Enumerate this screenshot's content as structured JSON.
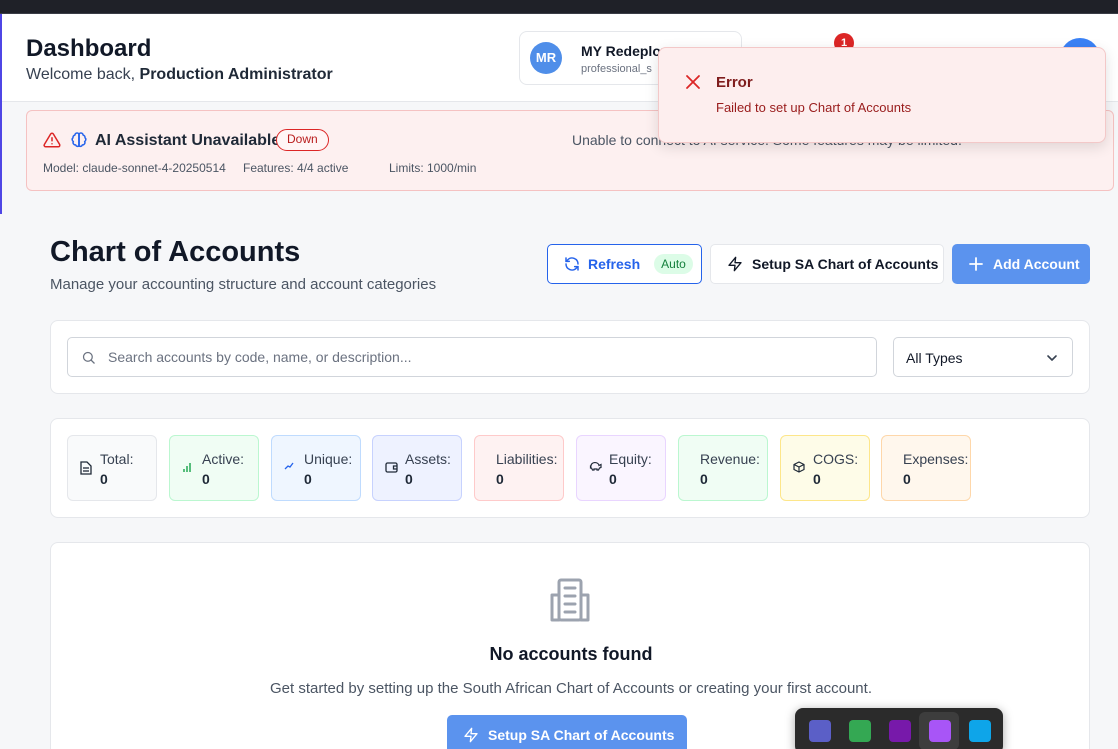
{
  "header": {
    "title": "Dashboard",
    "welcome_prefix": "Welcome back, ",
    "user_name": "Production Administrator"
  },
  "company": {
    "initials": "MR",
    "name": "MY Redeploy",
    "plan": "professional_s"
  },
  "notifications": {
    "count": "1"
  },
  "ai_status": {
    "title": "AI Assistant Unavailable",
    "status_badge": "Down",
    "message": "Unable to connect to AI service. Some features may be limited.",
    "model": "Model: claude-sonnet-4-20250514",
    "features": "Features: 4/4 active",
    "limits": "Limits: 1000/min"
  },
  "toast": {
    "title": "Error",
    "message": "Failed to set up Chart of Accounts"
  },
  "page": {
    "title": "Chart of Accounts",
    "subtitle": "Manage your accounting structure and account categories"
  },
  "actions": {
    "refresh_label": "Refresh",
    "auto_badge": "Auto",
    "setup_label": "Setup SA Chart of Accounts",
    "add_label": "Add Account"
  },
  "filters": {
    "search_placeholder": "Search accounts by code, name, or description...",
    "type_selected": "All Types"
  },
  "stats": [
    {
      "label": "Total:",
      "value": "0",
      "icon": "document-icon",
      "bg": "#f9fafb",
      "border": "#e5e7eb"
    },
    {
      "label": "Active:",
      "value": "0",
      "icon": "signal-bars-icon",
      "bg": "#f0fdf4",
      "border": "#bbf7d0"
    },
    {
      "label": "Unique:",
      "value": "0",
      "icon": "trend-up-icon",
      "bg": "#eff6ff",
      "border": "#bfdbfe"
    },
    {
      "label": "Assets:",
      "value": "0",
      "icon": "wallet-icon",
      "bg": "#eef2ff",
      "border": "#c7d2fe"
    },
    {
      "label": "Liabilities:",
      "value": "0",
      "icon": "",
      "bg": "#fef2f2",
      "border": "#fecaca"
    },
    {
      "label": "Equity:",
      "value": "0",
      "icon": "piggy-bank-icon",
      "bg": "#faf5ff",
      "border": "#e9d5ff"
    },
    {
      "label": "Revenue:",
      "value": "0",
      "icon": "",
      "bg": "#f0fdf4",
      "border": "#bbf7d0"
    },
    {
      "label": "COGS:",
      "value": "0",
      "icon": "package-icon",
      "bg": "#fefce8",
      "border": "#fde68a"
    },
    {
      "label": "Expenses:",
      "value": "0",
      "icon": "",
      "bg": "#fff7ed",
      "border": "#fed7aa"
    }
  ],
  "empty_state": {
    "title": "No accounts found",
    "message": "Get started by setting up the South African Chart of Accounts or creating your first account.",
    "button_label": "Setup SA Chart of Accounts"
  },
  "taskbar": {
    "apps": [
      {
        "icon": "teams-icon",
        "color": "#5b5fc7"
      },
      {
        "icon": "google-drive-icon",
        "color": "#34a853"
      },
      {
        "icon": "onenote-icon",
        "color": "#7719aa"
      },
      {
        "icon": "feather-pen-icon",
        "color": "#a855f7"
      },
      {
        "icon": "window-app-icon",
        "color": "#0ea5e9"
      }
    ]
  },
  "colors": {
    "primary": "#2563eb",
    "primary_button": "#5b93ee",
    "danger": "#dc2626",
    "success": "#15803d"
  }
}
